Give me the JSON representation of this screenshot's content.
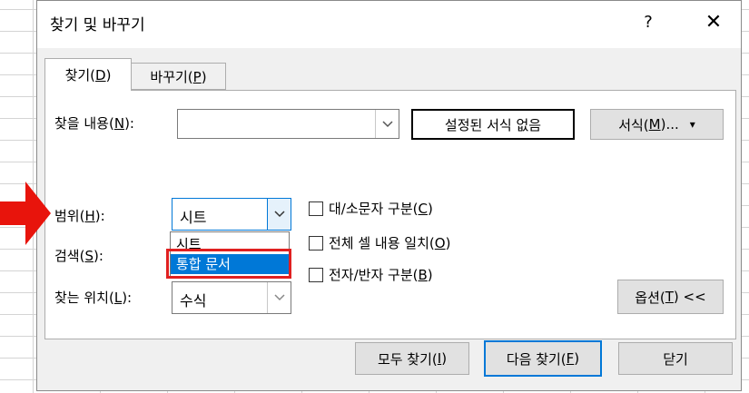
{
  "dialog": {
    "title": "찾기 및 바꾸기",
    "help": "?",
    "close": "✕"
  },
  "tabs": [
    {
      "prefix": "찾기(",
      "mnemonic": "D",
      "suffix": ")"
    },
    {
      "prefix": "바꾸기(",
      "mnemonic": "P",
      "suffix": ")"
    }
  ],
  "find": {
    "label_prefix": "찾을 내용(",
    "label_mnemonic": "N",
    "label_suffix": "):",
    "value": ""
  },
  "format_status": "설정된 서식 없음",
  "format_button": {
    "prefix": "서식(",
    "mnemonic": "M",
    "suffix": ")...",
    "arrow": "▾"
  },
  "scope": {
    "label_prefix": "범위(",
    "label_mnemonic": "H",
    "label_suffix": "):",
    "value": "시트",
    "options": [
      "시트",
      "통합 문서"
    ],
    "highlighted": "통합 문서"
  },
  "search": {
    "label_prefix": "검색(",
    "label_mnemonic": "S",
    "label_suffix": "):"
  },
  "look_in": {
    "label_prefix": "찾는 위치(",
    "label_mnemonic": "L",
    "label_suffix": "):",
    "value": "수식"
  },
  "checkboxes": [
    {
      "prefix": "대/소문자 구분(",
      "mnemonic": "C",
      "suffix": ")",
      "checked": false
    },
    {
      "prefix": "전체 셀 내용 일치(",
      "mnemonic": "O",
      "suffix": ")",
      "checked": false
    },
    {
      "prefix": "전자/반자 구분(",
      "mnemonic": "B",
      "suffix": ")",
      "checked": false
    }
  ],
  "options_button": {
    "prefix": "옵션(",
    "mnemonic": "T",
    "suffix": ") <<"
  },
  "buttons": {
    "find_all": {
      "prefix": "모두 찾기(",
      "mnemonic": "I",
      "suffix": ")"
    },
    "find_next": {
      "prefix": "다음 찾기(",
      "mnemonic": "F",
      "suffix": ")"
    },
    "close": "닫기"
  },
  "colors": {
    "highlight": "#0078d7",
    "annotation": "#e02020"
  },
  "icons": {
    "combo_arrow": "chevron-down-icon",
    "annotation_arrow": "red-arrow-icon"
  }
}
